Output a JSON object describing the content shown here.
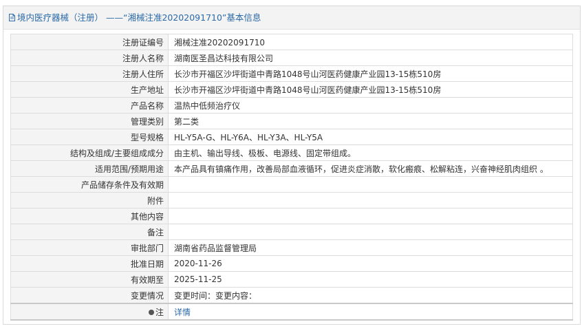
{
  "header": {
    "icon": "document-icon",
    "title": "境内医疗器械（注册） ——“湘械注准20202091710”基本信息"
  },
  "rows": [
    {
      "label": "注册证编号",
      "value": "湘械注准20202091710"
    },
    {
      "label": "注册人名称",
      "value": "湖南医圣昌达科技有限公司"
    },
    {
      "label": "注册人住所",
      "value": "长沙市开福区沙坪街道中青路1048号山河医药健康产业园13-15栋510房"
    },
    {
      "label": "生产地址",
      "value": "长沙市开福区沙坪街道中青路1048号山河医药健康产业园13-15栋510房"
    },
    {
      "label": "产品名称",
      "value": "温热中低频治疗仪"
    },
    {
      "label": "管理类别",
      "value": "第二类"
    },
    {
      "label": "型号规格",
      "value": "HL-Y5A-G、HL-Y6A、HL-Y3A、HL-Y5A"
    },
    {
      "label": "结构及组成/主要组成成分",
      "value": "由主机、输出导线、极板、电源线、固定带组成。"
    },
    {
      "label": "适用范围/预期用途",
      "value": "本产品具有镇痛作用，改善局部血液循环，促进炎症消散，软化瘢痕、松解粘连，兴奋神经肌肉组织 。"
    },
    {
      "label": "产品储存条件及有效期",
      "value": ""
    },
    {
      "label": "附件",
      "value": ""
    },
    {
      "label": "其他内容",
      "value": ""
    },
    {
      "label": "备注",
      "value": ""
    },
    {
      "label": "审批部门",
      "value": "湖南省药品监督管理局"
    },
    {
      "label": "批准日期",
      "value": "2020-11-26"
    },
    {
      "label": "有效期至",
      "value": "2025-11-25"
    },
    {
      "label": "变更情况",
      "value": "变更时间：变更内容："
    }
  ],
  "note_row": {
    "icon": "info-dot-icon",
    "label": "注",
    "link": "详情"
  }
}
